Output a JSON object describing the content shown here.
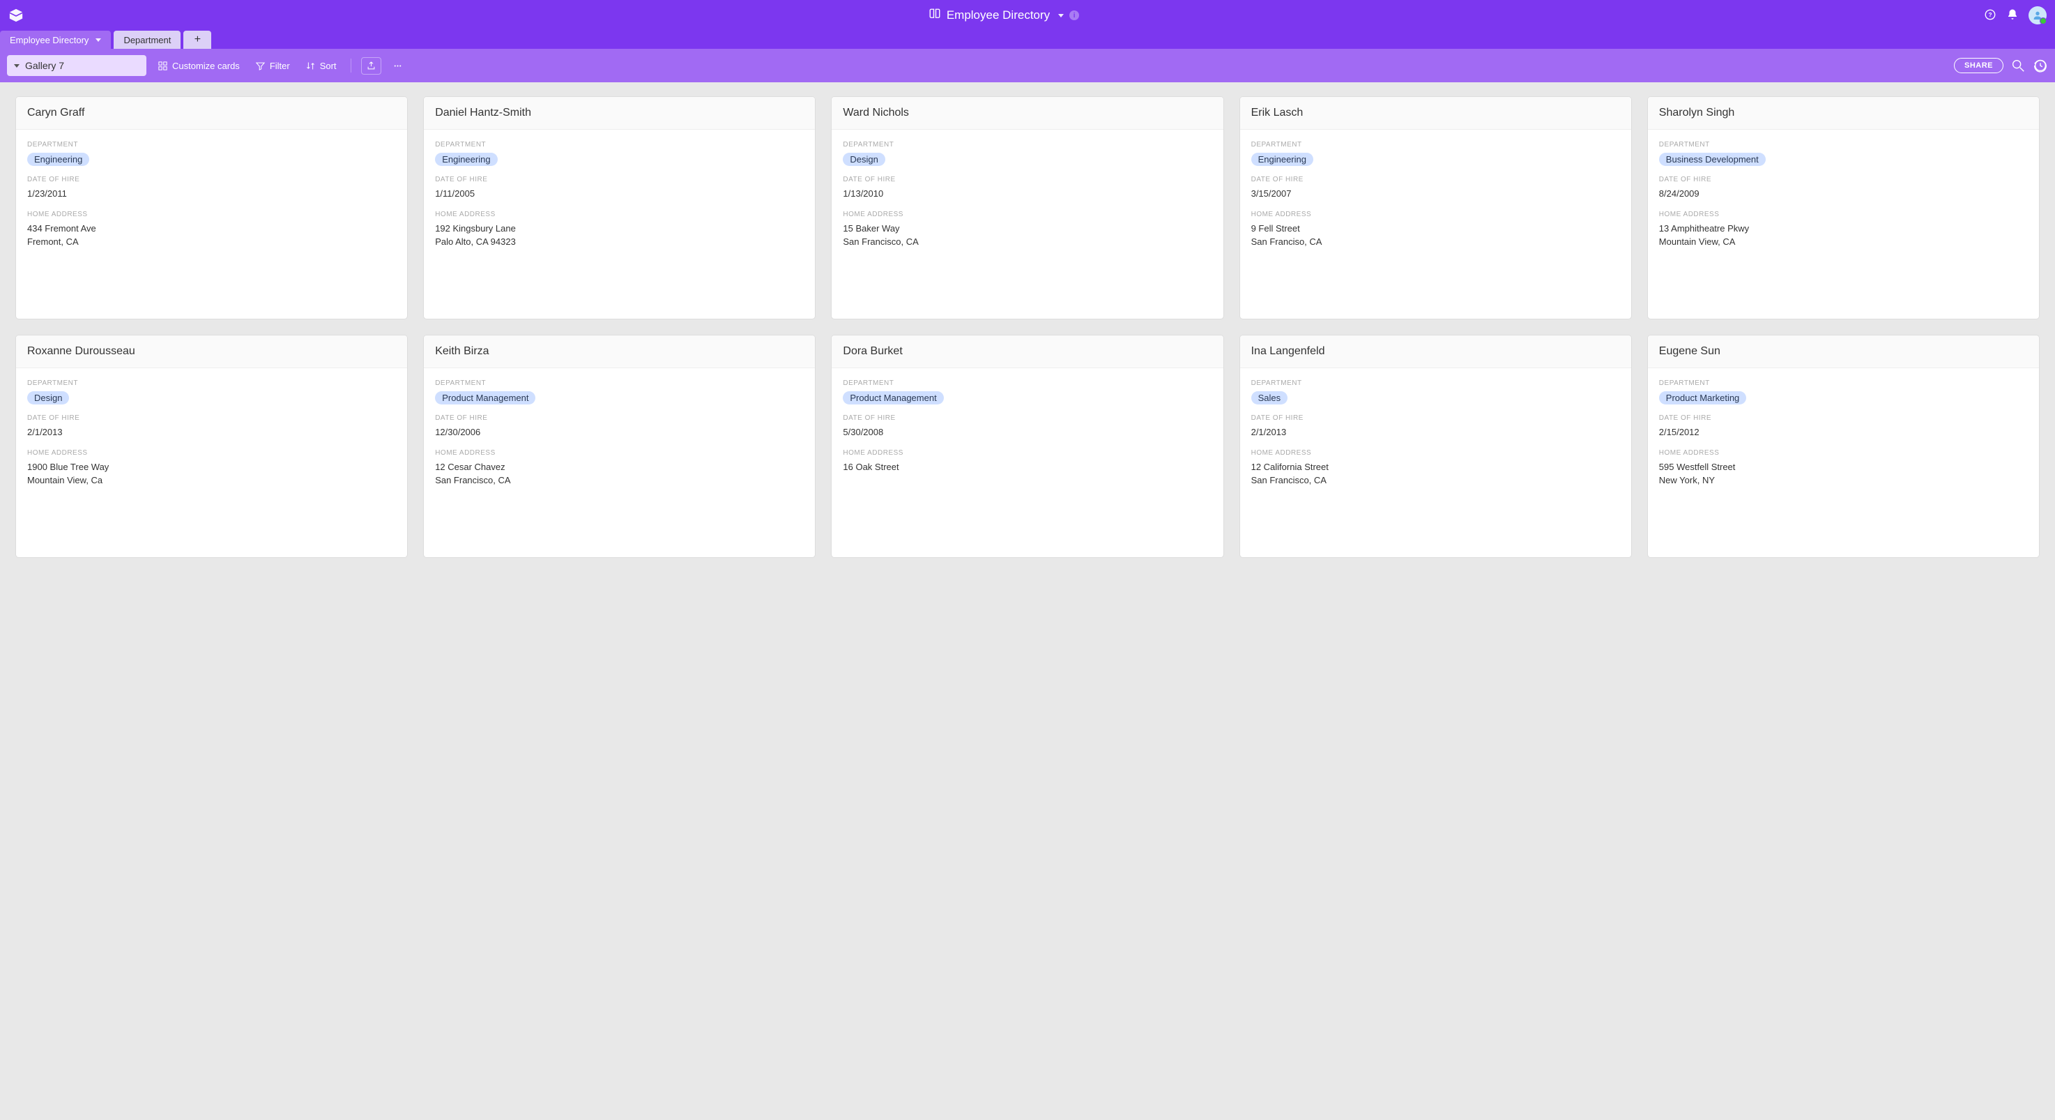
{
  "colors": {
    "primary": "#7c37ef",
    "primary_light": "#a16af3",
    "tag_bg": "#cfdfff"
  },
  "header": {
    "base_title": "Employee Directory"
  },
  "tables": {
    "active": "Employee Directory",
    "inactive": "Department",
    "add_label": "+"
  },
  "viewbar": {
    "view_name": "Gallery 7",
    "customize": "Customize cards",
    "filter": "Filter",
    "sort": "Sort",
    "share": "SHARE"
  },
  "field_labels": {
    "department": "DEPARTMENT",
    "date_of_hire": "DATE OF HIRE",
    "home_address": "HOME ADDRESS"
  },
  "cards": [
    {
      "name": "Caryn Graff",
      "department": "Engineering",
      "date_of_hire": "1/23/2011",
      "home_address": "434 Fremont Ave\nFremont, CA"
    },
    {
      "name": "Daniel Hantz-Smith",
      "department": "Engineering",
      "date_of_hire": "1/11/2005",
      "home_address": "192 Kingsbury Lane\nPalo Alto, CA 94323"
    },
    {
      "name": "Ward Nichols",
      "department": "Design",
      "date_of_hire": "1/13/2010",
      "home_address": "15 Baker Way\nSan Francisco, CA"
    },
    {
      "name": "Erik Lasch",
      "department": "Engineering",
      "date_of_hire": "3/15/2007",
      "home_address": "9 Fell Street\nSan Franciso, CA"
    },
    {
      "name": "Sharolyn Singh",
      "department": "Business Development",
      "date_of_hire": "8/24/2009",
      "home_address": "13 Amphitheatre Pkwy\nMountain View, CA"
    },
    {
      "name": "Roxanne Durousseau",
      "department": "Design",
      "date_of_hire": "2/1/2013",
      "home_address": "1900 Blue Tree Way\nMountain View, Ca"
    },
    {
      "name": "Keith Birza",
      "department": "Product Management",
      "date_of_hire": "12/30/2006",
      "home_address": "12 Cesar Chavez\nSan Francisco, CA"
    },
    {
      "name": "Dora Burket",
      "department": "Product Management",
      "date_of_hire": "5/30/2008",
      "home_address": "16 Oak Street"
    },
    {
      "name": "Ina Langenfeld",
      "department": "Sales",
      "date_of_hire": "2/1/2013",
      "home_address": "12 California Street\nSan Francisco, CA"
    },
    {
      "name": "Eugene Sun",
      "department": "Product Marketing",
      "date_of_hire": "2/15/2012",
      "home_address": "595 Westfell Street\nNew York, NY"
    }
  ]
}
